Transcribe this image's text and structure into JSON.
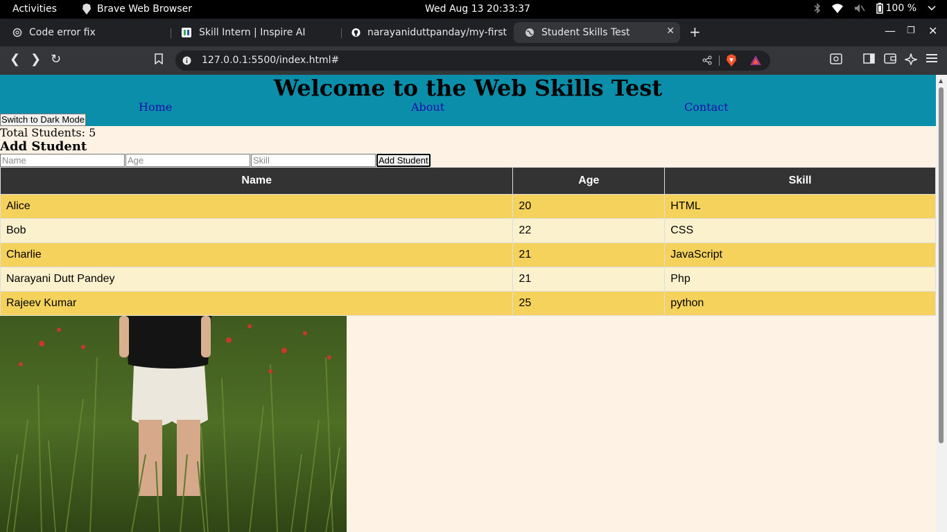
{
  "system_bar": {
    "activities": "Activities",
    "app_name": "Brave Web Browser",
    "clock": "Wed Aug 13  20:33:37",
    "battery": "100 %"
  },
  "tabs": [
    {
      "title": "Code error fix",
      "icon": "openai-icon"
    },
    {
      "title": "Skill Intern | Inspire AI",
      "icon": "site-icon"
    },
    {
      "title": "narayaniduttpanday/my-first",
      "icon": "github-icon"
    },
    {
      "title": "Student Skills Test",
      "icon": "globe-icon",
      "active": true
    }
  ],
  "toolbar": {
    "url": "127.0.0.1:5500/index.html#"
  },
  "page": {
    "title": "Welcome to the Web Skills Test",
    "nav": [
      "Home",
      "About",
      "Contact"
    ],
    "dark_mode_button": "Switch to Dark Mode",
    "total_students": "Total Students: 5",
    "add_title": "Add Student",
    "form": {
      "name_placeholder": "Name",
      "age_placeholder": "Age",
      "skill_placeholder": "Skill",
      "submit_label": "Add Student"
    },
    "table": {
      "headers": [
        "Name",
        "Age",
        "Skill"
      ],
      "rows": [
        [
          "Alice",
          "20",
          "HTML"
        ],
        [
          "Bob",
          "22",
          "CSS"
        ],
        [
          "Charlie",
          "21",
          "JavaScript"
        ],
        [
          "Narayani Dutt Pandey",
          "21",
          "Php"
        ],
        [
          "Rajeev Kumar",
          "25",
          "python"
        ]
      ]
    },
    "colors": {
      "header_bg": "#0a8eaa",
      "page_bg": "#fdf2e3",
      "row_odd": "#f5d25c",
      "row_even": "#fbf1cd",
      "table_head": "#333333"
    }
  }
}
